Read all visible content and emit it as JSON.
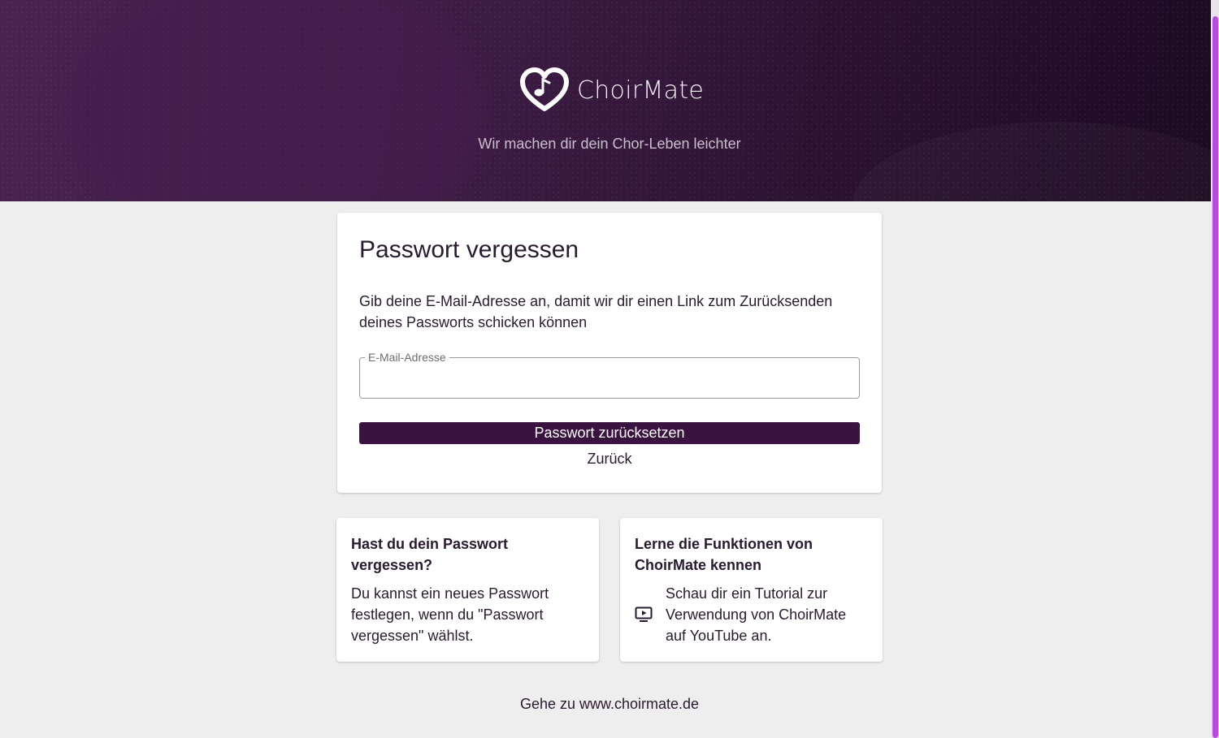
{
  "header": {
    "brand": "ChoirMate",
    "logo_icon": "heart-music-note-icon",
    "tagline": "Wir machen dir dein Chor-Leben leichter"
  },
  "reset_card": {
    "title": "Passwort vergessen",
    "description": "Gib deine E-Mail-Adresse an, damit wir dir einen Link zum Zurücksenden deines Passworts schicken können",
    "email_label": "E-Mail-Adresse",
    "email_value": "",
    "submit_label": "Passwort zurücksetzen",
    "back_label": "Zurück"
  },
  "info_cards": {
    "forgot": {
      "title": "Hast du dein Passwort vergessen?",
      "body": "Du kannst ein neues Passwort festlegen, wenn du \"Passwort vergessen\" wählst."
    },
    "learn": {
      "title": "Lerne die Funktionen von ChoirMate kennen",
      "icon": "video-play-icon",
      "body": "Schau dir ein Tutorial zur Verwendung von ChoirMate auf YouTube an."
    }
  },
  "footer": {
    "link_label": "Gehe zu www.choirmate.de"
  },
  "colors": {
    "header_bg": "#3f1d46",
    "primary_button": "#3a1340",
    "page_bg": "#eeeeee",
    "scrollbar_thumb": "#b64be3"
  }
}
